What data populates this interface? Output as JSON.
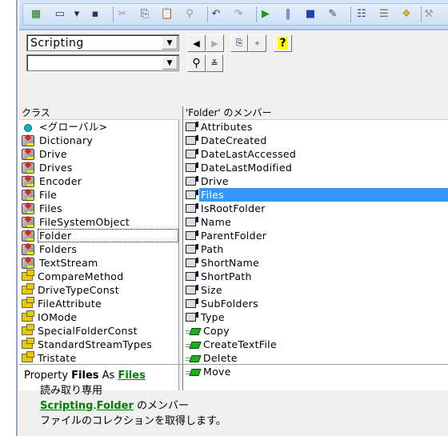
{
  "toolbar": {
    "icons": [
      "excel-icon",
      "userform-icon",
      "dropdown-arrow-icon",
      "save-icon",
      "cut-icon",
      "copy-icon",
      "paste-icon",
      "find-icon",
      "undo-icon",
      "redo-icon",
      "run-icon",
      "pause-icon",
      "stop-icon",
      "design-mode-icon",
      "project-explorer-icon",
      "properties-icon",
      "object-browser-icon",
      "toolbox-icon"
    ]
  },
  "library_combo": {
    "value": "Scripting"
  },
  "search_combo": {
    "value": ""
  },
  "columns": {
    "classes": "クラス",
    "members": "'Folder' のメンバー"
  },
  "classes": [
    {
      "label": "<グローバル>",
      "type": "global"
    },
    {
      "label": "Dictionary",
      "type": "class"
    },
    {
      "label": "Drive",
      "type": "class"
    },
    {
      "label": "Drives",
      "type": "class"
    },
    {
      "label": "Encoder",
      "type": "class"
    },
    {
      "label": "File",
      "type": "class"
    },
    {
      "label": "Files",
      "type": "class"
    },
    {
      "label": "FileSystemObject",
      "type": "class"
    },
    {
      "label": "Folder",
      "type": "class",
      "focused": true
    },
    {
      "label": "Folders",
      "type": "class"
    },
    {
      "label": "TextStream",
      "type": "class"
    },
    {
      "label": "CompareMethod",
      "type": "enum"
    },
    {
      "label": "DriveTypeConst",
      "type": "enum"
    },
    {
      "label": "FileAttribute",
      "type": "enum"
    },
    {
      "label": "IOMode",
      "type": "enum"
    },
    {
      "label": "SpecialFolderConst",
      "type": "enum"
    },
    {
      "label": "StandardStreamTypes",
      "type": "enum"
    },
    {
      "label": "Tristate",
      "type": "enum"
    }
  ],
  "members": [
    {
      "label": "Attributes",
      "type": "prop"
    },
    {
      "label": "DateCreated",
      "type": "prop"
    },
    {
      "label": "DateLastAccessed",
      "type": "prop"
    },
    {
      "label": "DateLastModified",
      "type": "prop"
    },
    {
      "label": "Drive",
      "type": "prop"
    },
    {
      "label": "Files",
      "type": "prop",
      "selected": true
    },
    {
      "label": "IsRootFolder",
      "type": "prop"
    },
    {
      "label": "Name",
      "type": "prop"
    },
    {
      "label": "ParentFolder",
      "type": "prop"
    },
    {
      "label": "Path",
      "type": "prop"
    },
    {
      "label": "ShortName",
      "type": "prop"
    },
    {
      "label": "ShortPath",
      "type": "prop"
    },
    {
      "label": "Size",
      "type": "prop"
    },
    {
      "label": "SubFolders",
      "type": "prop"
    },
    {
      "label": "Type",
      "type": "prop"
    },
    {
      "label": "Copy",
      "type": "meth"
    },
    {
      "label": "CreateTextFile",
      "type": "meth"
    },
    {
      "label": "Delete",
      "type": "meth"
    },
    {
      "label": "Move",
      "type": "meth"
    }
  ],
  "detail": {
    "kind": "Property",
    "name": "Files",
    "as": "As",
    "type_link": "Files",
    "readonly": "読み取り専用",
    "lib_link": "Scripting",
    "dot": ".",
    "class_link": "Folder",
    "member_of": " のメンバー",
    "description": "ファイルのコレクションを取得します。"
  }
}
